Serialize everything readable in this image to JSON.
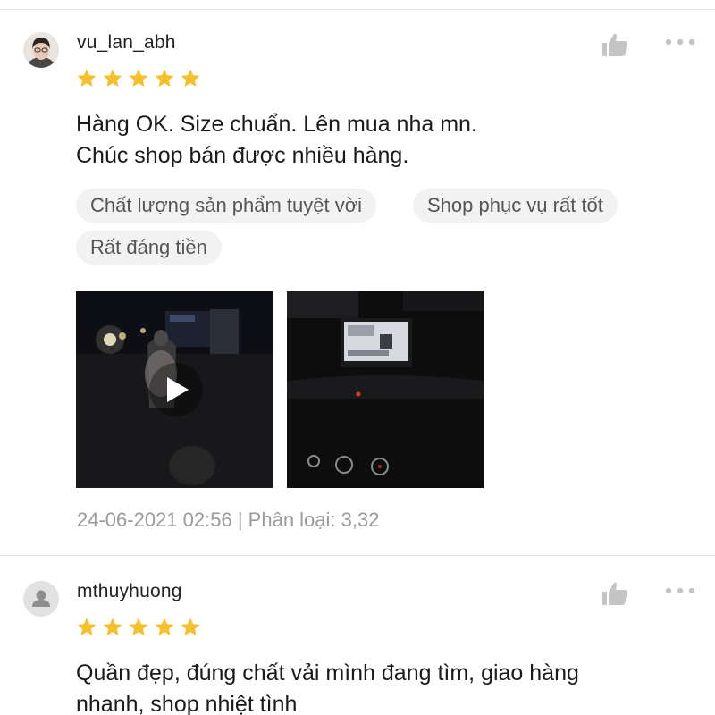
{
  "colors": {
    "star": "#f5c02c",
    "icon": "#c4c4c4",
    "tag_bg": "#f2f2f2",
    "meta_text": "#9a9a9a",
    "divider": "#e4e4e4"
  },
  "reviews": [
    {
      "username": "vu_lan_abh",
      "rating": 5,
      "text": "Hàng OK.  Size chuẩn.  Lên mua nha mn.\nChúc shop bán được nhiều hàng.",
      "tags": [
        "Chất lượng sản phẩm tuyệt vời",
        "Shop phục vụ rất tốt",
        "Rất đáng tiền"
      ],
      "media": [
        {
          "type": "video",
          "icon": "play-icon"
        },
        {
          "type": "image"
        }
      ],
      "timestamp": "24-06-2021 02:56",
      "separator": "|",
      "variation_label": "Phân loại:",
      "variation_value": "3,32"
    },
    {
      "username": "mthuyhuong",
      "rating": 5,
      "text": "Quần đẹp, đúng chất vải mình đang tìm, giao hàng\nnhanh, shop nhiệt tình"
    }
  ],
  "icons": {
    "like": "thumbs-up-icon",
    "more": "more-options-icon",
    "star": "star-icon",
    "default_avatar": "user-icon"
  }
}
